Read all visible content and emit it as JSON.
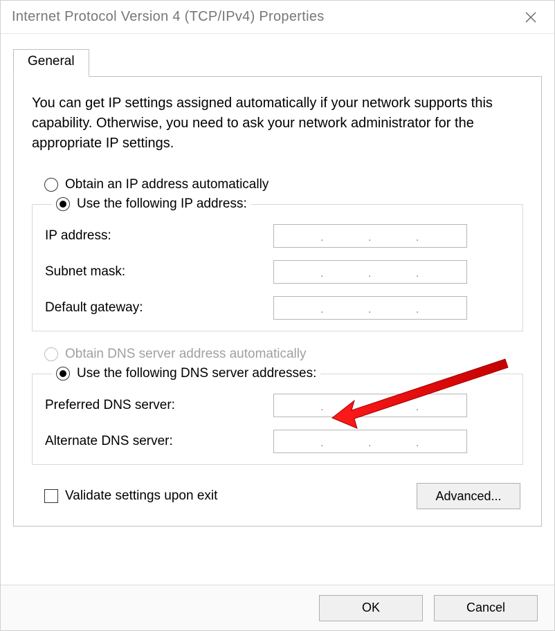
{
  "window_title": "Internet Protocol Version 4 (TCP/IPv4) Properties",
  "tab_label": "General",
  "intro": "You can get IP settings assigned automatically if your network supports this capability. Otherwise, you need to ask your network administrator for the appropriate IP settings.",
  "ip": {
    "auto_label": "Obtain an IP address automatically",
    "auto_selected": false,
    "manual_label": "Use the following IP address:",
    "manual_selected": true,
    "fields": {
      "ip_address_label": "IP address:",
      "subnet_mask_label": "Subnet mask:",
      "default_gateway_label": "Default gateway:"
    }
  },
  "dns": {
    "auto_label": "Obtain DNS server address automatically",
    "auto_enabled": false,
    "auto_selected": false,
    "manual_label": "Use the following DNS server addresses:",
    "manual_selected": true,
    "fields": {
      "preferred_label": "Preferred DNS server:",
      "alternate_label": "Alternate DNS server:"
    }
  },
  "validate_label": "Validate settings upon exit",
  "validate_checked": false,
  "buttons": {
    "advanced": "Advanced...",
    "ok": "OK",
    "cancel": "Cancel"
  }
}
